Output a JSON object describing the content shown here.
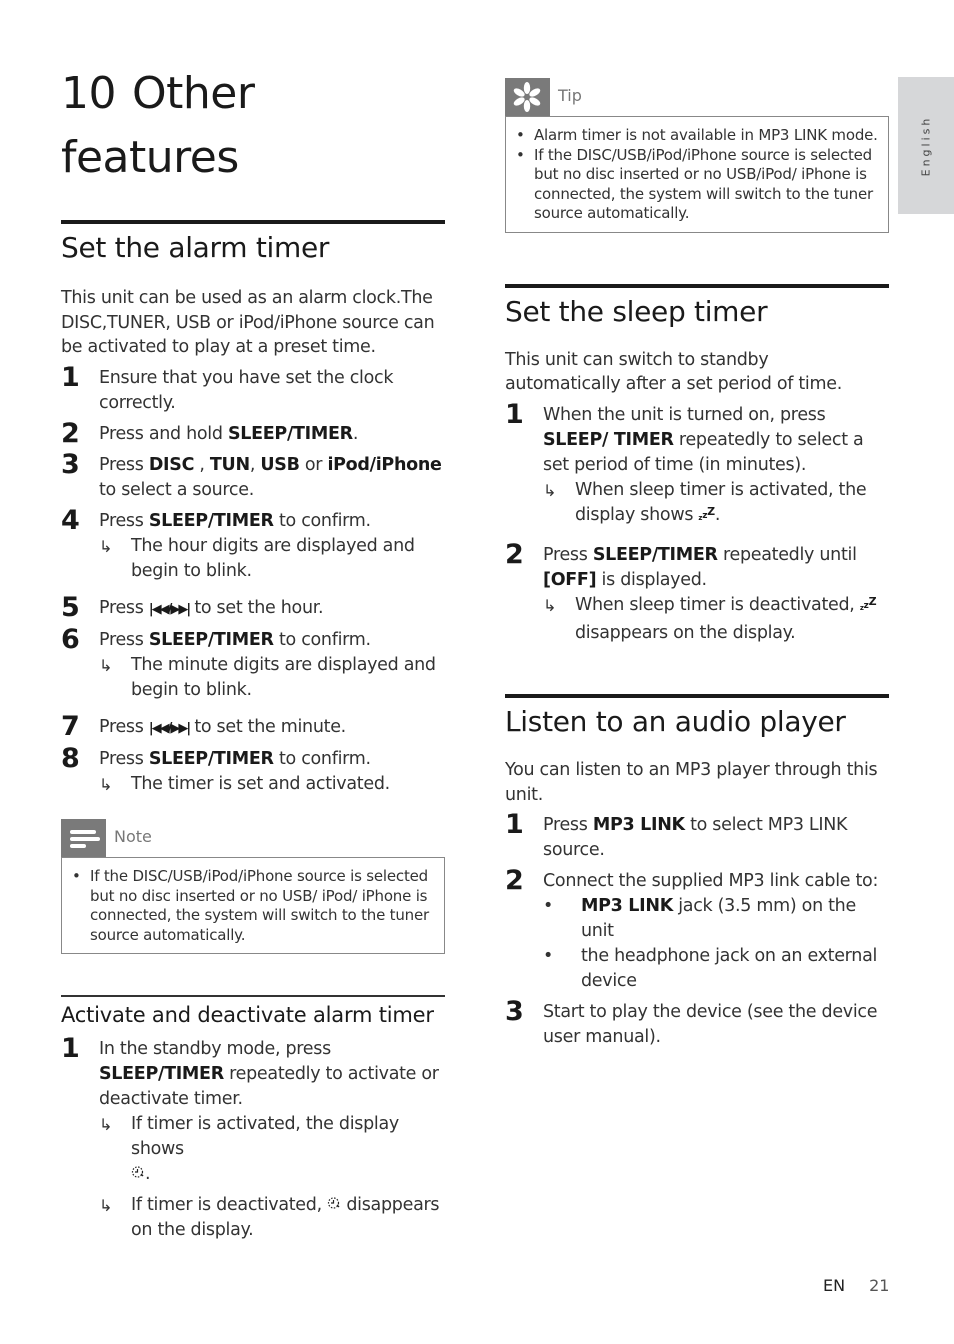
{
  "chapter": {
    "number": "10",
    "title": "Other features"
  },
  "language_tab": "English",
  "alarm": {
    "title": "Set the alarm timer",
    "intro": "This unit can be used as an alarm clock.The DISC,TUNER, USB or iPod/iPhone source can be activated to play at a preset time.",
    "steps": [
      {
        "num": "1",
        "text": "Ensure that you have set the clock correctly."
      },
      {
        "num": "2",
        "pre": "Press and hold ",
        "bold": "SLEEP/TIMER",
        "post": "."
      },
      {
        "num": "3",
        "pre": "Press ",
        "b1": "DISC",
        "s1": " , ",
        "b2": "TUN",
        "s2": ", ",
        "b3": "USB",
        "s3": " or ",
        "b4": "iPod/iPhone",
        "post": " to select a source."
      },
      {
        "num": "4",
        "pre": "Press ",
        "bold": "SLEEP/TIMER",
        "post": " to confirm.",
        "result": "The hour digits are displayed and begin to blink."
      },
      {
        "num": "5",
        "pre": "Press ",
        "glyph": "prev-next-icon",
        "post": " to set the hour."
      },
      {
        "num": "6",
        "pre": "Press ",
        "bold": "SLEEP/TIMER",
        "post": " to confirm.",
        "result": "The minute digits are displayed and begin to blink."
      },
      {
        "num": "7",
        "pre": "Press ",
        "glyph": "prev-next-icon",
        "post": " to set the minute."
      },
      {
        "num": "8",
        "pre": "Press ",
        "bold": "SLEEP/TIMER",
        "post": " to confirm.",
        "result": "The timer is set and activated."
      }
    ],
    "note": {
      "label": "Note",
      "icon": "note-lines-icon",
      "items": [
        "If the DISC/USB/iPod/iPhone source is selected but no disc inserted or no USB/ iPod/ iPhone is connected, the system will switch to the tuner source automatically."
      ]
    },
    "activate": {
      "title": "Activate and deactivate alarm timer",
      "step_num": "1",
      "pre": "In the standby mode, press ",
      "bold": "SLEEP/TIMER",
      "post": " repeatedly to activate or deactivate timer.",
      "result1_pre": "If timer is activated, the display shows ",
      "result1_post": ".",
      "result2_pre": "If timer is deactivated, ",
      "result2_post": " disappears on the display.",
      "icon": "alarm-clock-icon"
    }
  },
  "tip": {
    "label": "Tip",
    "icon": "tip-asterisk-icon",
    "items": [
      "Alarm timer is not available in MP3 LINK mode.",
      "If the DISC/USB/iPod/iPhone source is selected but no disc inserted or no USB/iPod/ iPhone is connected, the system will switch to the tuner source automatically."
    ]
  },
  "sleep": {
    "title": "Set the sleep timer",
    "intro": "This unit can switch to standby automatically after a set period of time.",
    "steps": [
      {
        "num": "1",
        "pre": "When the unit is turned on, press ",
        "bold": "SLEEP/ TIMER",
        "post": " repeatedly to select a set period of time (in minutes).",
        "result_pre": "When sleep timer is activated, the display shows ",
        "result_post": "."
      },
      {
        "num": "2",
        "pre": "Press ",
        "bold": "SLEEP/TIMER",
        "post": " repeatedly until ",
        "bold2": "[OFF]",
        "post2": " is displayed.",
        "result_pre": "When sleep timer is deactivated, ",
        "result_post": " disappears on the display."
      }
    ],
    "icon": "sleep-zzz-icon"
  },
  "audio": {
    "title": "Listen to an audio player",
    "intro": "You can listen to an MP3 player through this unit.",
    "steps": [
      {
        "num": "1",
        "pre": "Press ",
        "bold": "MP3 LINK",
        "post": " to select MP3 LINK source."
      },
      {
        "num": "2",
        "text": "Connect the supplied MP3 link cable to:",
        "bullets": [
          {
            "bold": "MP3 LINK",
            "post": " jack (3.5 mm) on the unit"
          },
          {
            "text": "the headphone jack on an external device"
          }
        ]
      },
      {
        "num": "3",
        "text": "Start to play the device (see the device user manual)."
      }
    ]
  },
  "footer": {
    "lang": "EN",
    "page": "21"
  }
}
